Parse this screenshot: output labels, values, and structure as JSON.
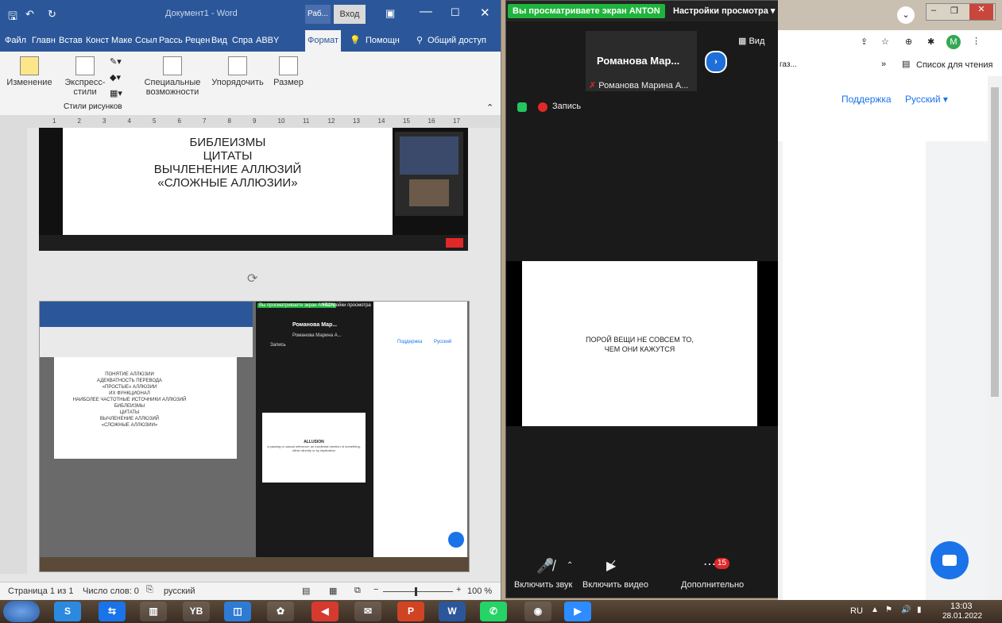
{
  "word": {
    "title": "Документ1  -  Word",
    "title_tab1": "Раб...",
    "login": "Вход",
    "menu": [
      "Файл",
      "Главн",
      "Встав",
      "Конст",
      "Маке",
      "Ссыл",
      "Рассь",
      "Рецен",
      "Вид",
      "Спра",
      "ABBY",
      "Формат"
    ],
    "help": "Помощн",
    "share": "Общий доступ",
    "ribbon": {
      "change": "Изменение",
      "express": "Экспресс-",
      "express2": "стили",
      "special": "Специальные",
      "special2": "возможности",
      "arrange": "Упорядочить",
      "size": "Размер",
      "group": "Стили рисунков"
    },
    "ruler_marks": [
      "1",
      "2",
      "3",
      "4",
      "5",
      "6",
      "7",
      "8",
      "9",
      "10",
      "11",
      "12",
      "13",
      "14",
      "15",
      "16",
      "17"
    ],
    "slide1_lines": [
      "БИБЛЕИЗМЫ",
      "ЦИТАТЫ",
      "ВЫЧЛЕНЕНИЕ АЛЛЮЗИЙ",
      "«СЛОЖНЫЕ АЛЛЮЗИИ»"
    ],
    "slide2_lines": [
      "ПОНЯТИЕ АЛЛЮЗИИ",
      "АДЕКВАТНОСТЬ ПЕРЕВОДА",
      "«ПРОСТЫЕ» АЛЛЮЗИИ",
      "ИХ ФУНКЦИОНАЛ",
      "НАИБОЛЕЕ ЧАСТОТНЫЕ ИСТОЧНИКИ АЛЛЮЗИЙ",
      "БИБЛЕИЗМЫ",
      "ЦИТАТЫ",
      "ВЫЧЛЕНЕНИЕ АЛЛЮЗИЙ",
      "«СЛОЖНЫЕ АЛЛЮЗИИ»"
    ],
    "mini_share_banner": "Вы просматриваете экран ANTON",
    "mini_share_settings": "Настройки просмотра",
    "mini_name": "Романова Мар...",
    "mini_name_full": "Романова Марина А...",
    "mini_record": "Запись",
    "mini_slide_title": "ALLUSION",
    "mini_slide_body": "a passing or casual reference; an incidental mention of something, either directly or by implication",
    "mini_support": "Поддержка",
    "mini_lang": "Русский",
    "status": {
      "page": "Страница 1 из 1",
      "words": "Число слов: 0",
      "lang": "русский",
      "zoom": "100 %"
    }
  },
  "zoom": {
    "banner": "Вы просматриваете экран ANTON",
    "settings": "Настройки просмотра",
    "view": "Вид",
    "tile_name": "Романова  Мар...",
    "tile_full": "Романова Марина А...",
    "record": "Запись",
    "slide_line1": "ПОРОЙ ВЕЩИ НЕ СОВСЕМ ТО,",
    "slide_line2": "ЧЕМ ОНИ КАЖУТСЯ",
    "mute": "Включить звук",
    "video": "Включить видео",
    "more": "Дополнительно",
    "badge": "15"
  },
  "browser": {
    "bookmark_left": "газ...",
    "reading_list": "Список для чтения",
    "support": "Поддержка",
    "language": "Русский",
    "avatar_letter": "M"
  },
  "taskbar": {
    "lang": "RU",
    "time": "13:03",
    "date": "28.01.2022",
    "apps": [
      "S",
      "",
      "",
      "YB",
      "",
      "",
      "",
      "",
      "P",
      "W",
      "",
      "",
      "",
      ""
    ]
  }
}
